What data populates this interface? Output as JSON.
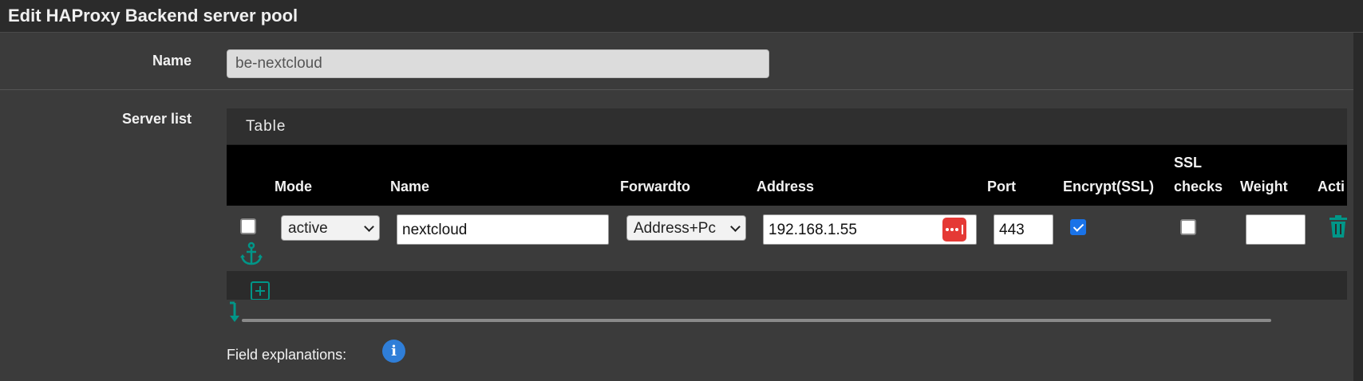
{
  "panel": {
    "title": "Edit HAProxy Backend server pool"
  },
  "fields": {
    "name_label": "Name",
    "name_value": "be-nextcloud",
    "server_list_label": "Server list"
  },
  "table": {
    "heading": "Table",
    "columns": {
      "mode": "Mode",
      "name": "Name",
      "forwardto": "Forwardto",
      "address": "Address",
      "port": "Port",
      "encrypt": "Encrypt(SSL)",
      "ssl_checks_line1": "SSL",
      "ssl_checks_line2": "checks",
      "weight": "Weight",
      "actions": "Acti"
    },
    "row": {
      "selected": false,
      "mode": "active",
      "name": "nextcloud",
      "forwardto": "Address+Pc",
      "address": "192.168.1.55",
      "port": "443",
      "encrypt_ssl": true,
      "ssl_checks": false,
      "weight": ""
    }
  },
  "footer": {
    "field_explanations": "Field explanations:",
    "info_glyph": "i"
  },
  "colors": {
    "accent": "#009688",
    "checkbox_checked": "#1a73e8",
    "password_badge": "#e53935",
    "info": "#2f7ed8"
  }
}
